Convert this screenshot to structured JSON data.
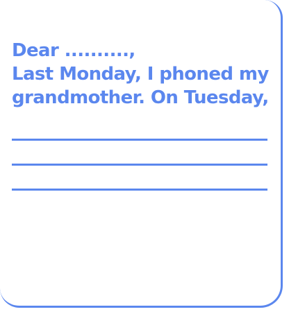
{
  "letter": {
    "greeting": "Dear ..........,",
    "line1": "Last Monday, I phoned my",
    "line2": "grandmother. On Tuesday,"
  },
  "colors": {
    "accent": "#5b87ee",
    "background": "#ffffff"
  },
  "blank_lines": 3
}
